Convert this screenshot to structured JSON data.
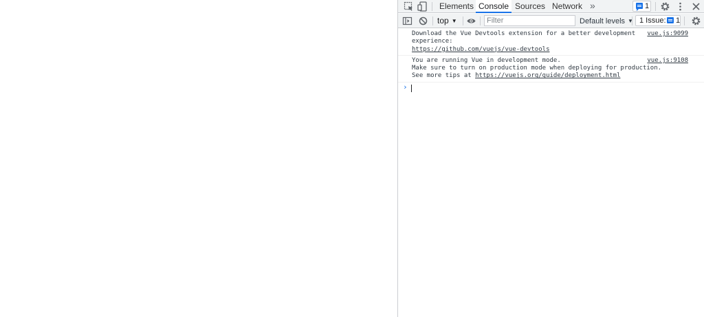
{
  "devtools": {
    "tabs": [
      {
        "label": "Elements",
        "active": false
      },
      {
        "label": "Console",
        "active": true
      },
      {
        "label": "Sources",
        "active": false
      },
      {
        "label": "Network",
        "active": false
      }
    ],
    "more_tabs_label": "»",
    "messages_badge_count": "1",
    "icons": [
      "inspect-element-icon",
      "device-toolbar-icon",
      "settings-gear-icon",
      "more-vert-icon",
      "close-icon"
    ]
  },
  "toolbar": {
    "context": "top",
    "filter_placeholder": "Filter",
    "levels": "Default levels",
    "issues_label": "1 Issue:",
    "issues_count": "1",
    "icons": [
      "sidebar-toggle-icon",
      "clear-console-icon",
      "eye-icon",
      "settings-gear-icon"
    ]
  },
  "console": {
    "messages": [
      {
        "lines": [
          "Download the Vue Devtools extension for a better development",
          "experience:"
        ],
        "link": "https://github.com/vuejs/vue-devtools",
        "source": "vue.js:9099"
      },
      {
        "lines": [
          "You are running Vue in development mode.",
          "Make sure to turn on production mode when deploying for production."
        ],
        "prefix": "See more tips at ",
        "link": "https://vuejs.org/guide/deployment.html",
        "source": "vue.js:9108"
      }
    ],
    "prompt_symbol": "›"
  },
  "colors": {
    "accent": "#1a73e8",
    "toolbar_bg": "#f1f3f4",
    "border": "#cbcdd1",
    "text": "#303942"
  }
}
